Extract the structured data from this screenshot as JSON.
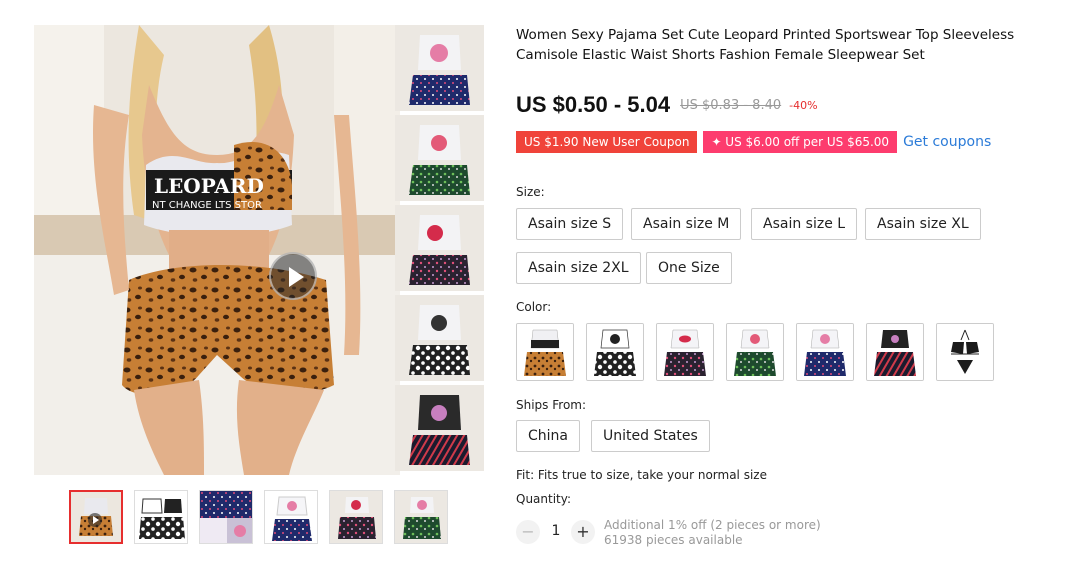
{
  "product": {
    "title": "Women Sexy Pajama Set Cute Leopard Printed Sportswear Top Sleeveless Camisole Elastic Waist Shorts Fashion Female Sleepwear Set",
    "main_image_text_1": "LEOPARD",
    "main_image_text_2": "NT CHANGE LTS STOR"
  },
  "price": {
    "current": "US $0.50 - 5.04",
    "original": "US $0.83 - 8.40",
    "discount": "-40%"
  },
  "coupons": {
    "new_user": "US $1.90 New User Coupon",
    "store": "✦ US $6.00 off per US $65.00",
    "get_link": "Get coupons"
  },
  "size": {
    "label": "Size:",
    "options": [
      "Asain size S",
      "Asain size M",
      "Asain size L",
      "Asain size XL",
      "Asain size 2XL",
      "One Size"
    ]
  },
  "color": {
    "label": "Color:",
    "swatch_count": 7
  },
  "ships_from": {
    "label": "Ships From:",
    "options": [
      "China",
      "United States"
    ]
  },
  "fit": "Fit: Fits true to size, take your normal size",
  "quantity": {
    "label": "Quantity:",
    "value": "1",
    "minus": "−",
    "plus": "+",
    "additional_offer": "Additional 1% off (2 pieces or more)",
    "available": "61938 pieces available"
  },
  "colors": {
    "accent_red": "#f0433a",
    "accent_pink": "#fd3c6e",
    "link_blue": "#2b7bd8",
    "leopard": "#b8732e"
  }
}
